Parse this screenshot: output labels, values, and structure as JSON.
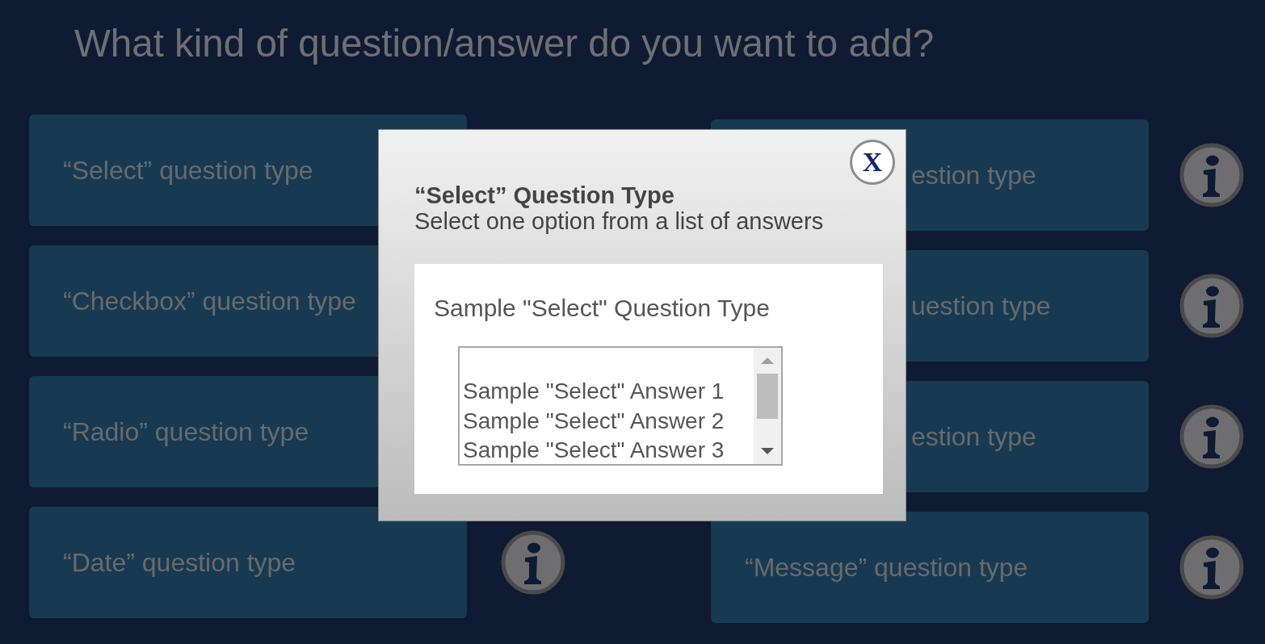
{
  "heading": "What kind of question/answer do you want to add?",
  "left_cards": [
    {
      "label": "“Select” question type",
      "info": false,
      "partial": false
    },
    {
      "label": "“Checkbox” question type",
      "info": false,
      "partial": false
    },
    {
      "label": "“Radio” question type",
      "info": false,
      "partial": false
    },
    {
      "label": "“Date” question type",
      "info": true,
      "partial": false
    }
  ],
  "right_cards": [
    {
      "label": "estion type",
      "info": true,
      "partial": true
    },
    {
      "label": "uestion type",
      "info": true,
      "partial": true
    },
    {
      "label": "estion type",
      "info": true,
      "partial": true
    },
    {
      "label": "“Message” question type",
      "info": true,
      "partial": false
    }
  ],
  "modal": {
    "close": "X",
    "title": "“Select” Question Type",
    "subtitle": "Select one option from a list of answers",
    "preview": {
      "question": "Sample \"Select\" Question Type",
      "options": [
        "Sample \"Select\" Answer 1",
        "Sample \"Select\" Answer 2",
        "Sample \"Select\" Answer 3"
      ]
    }
  }
}
